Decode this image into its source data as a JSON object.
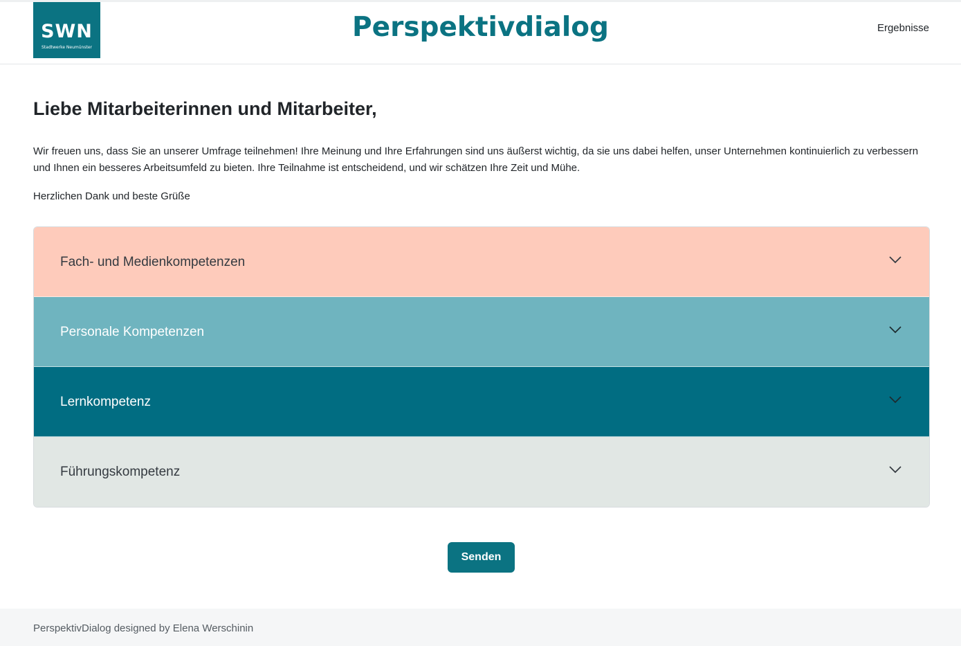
{
  "header": {
    "logo": {
      "main": "SWN",
      "sub": "Stadtwerke Neumünster"
    },
    "title": "Perspektivdialog",
    "nav_link": "Ergebnisse"
  },
  "main": {
    "greeting": "Liebe Mitarbeiterinnen und Mitarbeiter,",
    "intro": "Wir freuen uns, dass Sie an unserer Umfrage teilnehmen! Ihre Meinung und Ihre Erfahrungen sind uns äußerst wichtig, da sie uns dabei helfen, unser Unternehmen kontinuierlich zu verbessern und Ihnen ein besseres Arbeitsumfeld zu bieten. Ihre Teilnahme ist entscheidend, und wir schätzen Ihre Zeit und Mühe.",
    "closing": "Herzlichen Dank und beste Grüße",
    "accordion": [
      {
        "label": "Fach- und Medienkompetenzen",
        "bg": "#fecbbb",
        "fg": "#343a40",
        "icon": "chevron-down-icon"
      },
      {
        "label": "Personale Kompetenzen",
        "bg": "#6fb4bf",
        "fg": "#ffffff",
        "icon": "chevron-down-icon"
      },
      {
        "label": "Lernkompetenz",
        "bg": "#016d82",
        "fg": "#ffffff",
        "icon": "chevron-down-icon"
      },
      {
        "label": "Führungskompetenz",
        "bg": "#e1e7e4",
        "fg": "#343a40",
        "icon": "chevron-down-icon"
      }
    ],
    "submit_label": "Senden"
  },
  "footer": {
    "text": "PerspektivDialog designed by Elena Werschinin"
  },
  "colors": {
    "brand": "#0b7382",
    "footer_bg": "#f5f6f7"
  }
}
